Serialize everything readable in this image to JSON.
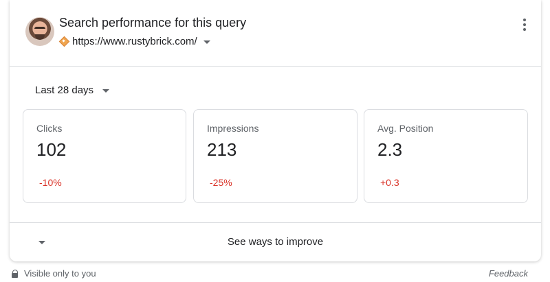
{
  "header": {
    "title": "Search performance for this query",
    "url": "https://www.rustybrick.com/",
    "avatar_icon": "user-avatar",
    "site_icon": "site-favicon",
    "menu_icon": "more-vert-icon"
  },
  "date_range": {
    "selected": "Last 28 days"
  },
  "metrics": [
    {
      "label": "Clicks",
      "value": "102",
      "delta": "-10%"
    },
    {
      "label": "Impressions",
      "value": "213",
      "delta": "-25%"
    },
    {
      "label": "Avg. Position",
      "value": "2.3",
      "delta": "+0.3"
    }
  ],
  "footer": {
    "improve_label": "See ways to improve"
  },
  "below": {
    "visibility": "Visible only to you",
    "feedback": "Feedback"
  },
  "colors": {
    "negative_delta": "#d93025",
    "border": "#dadce0",
    "text": "#202124",
    "secondary_text": "#5f6368"
  }
}
